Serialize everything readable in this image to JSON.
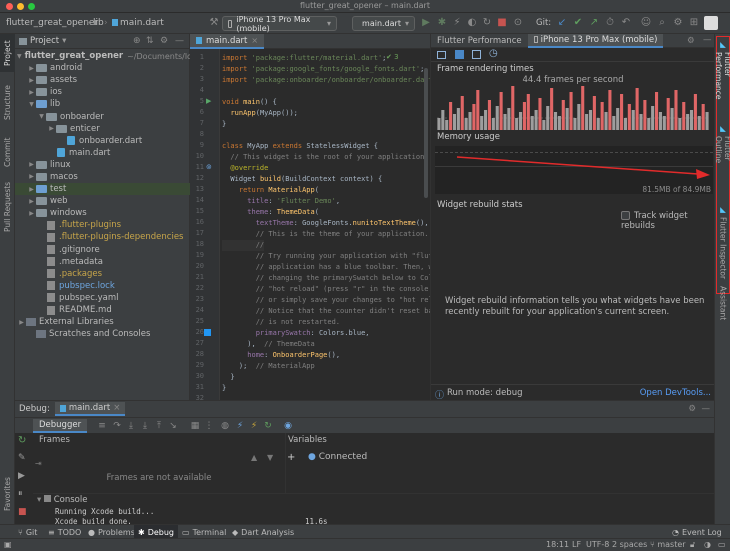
{
  "window": {
    "title": "flutter_great_opener – main.dart"
  },
  "navbar": {
    "breadcrumb": [
      "flutter_great_opener",
      "lib",
      "main.dart"
    ],
    "device_selector": "iPhone 13 Pro Max (mobile)",
    "run_config": "main.dart",
    "git_label": "Git:"
  },
  "left_strip": {
    "project": "Project",
    "structure": "Structure",
    "commit": "Commit",
    "pull_requests": "Pull Requests",
    "favorites": "Favorites"
  },
  "project_panel": {
    "title": "Project",
    "tree": [
      {
        "name": "flutter_great_opener",
        "suffix": "~/Documents/logrocket/flutter_great_opener",
        "indent": 0,
        "icon": "folder",
        "arrow": "open",
        "bold": true
      },
      {
        "name": "android",
        "indent": 1,
        "icon": "folder",
        "arrow": "closed",
        "color": ""
      },
      {
        "name": "assets",
        "indent": 1,
        "icon": "folder",
        "arrow": "closed",
        "color": ""
      },
      {
        "name": "ios",
        "indent": 1,
        "icon": "folder",
        "arrow": "closed",
        "color": ""
      },
      {
        "name": "lib",
        "indent": 1,
        "icon": "folder",
        "arrow": "open",
        "color": ""
      },
      {
        "name": "onboarder",
        "indent": 2,
        "icon": "folder",
        "arrow": "open",
        "color": ""
      },
      {
        "name": "enticer",
        "indent": 3,
        "icon": "folder",
        "arrow": "closed",
        "color": ""
      },
      {
        "name": "onboarder.dart",
        "indent": 4,
        "icon": "dart",
        "arrow": "",
        "color": ""
      },
      {
        "name": "main.dart",
        "indent": 3,
        "icon": "dart",
        "arrow": "",
        "color": ""
      },
      {
        "name": "linux",
        "indent": 1,
        "icon": "folder",
        "arrow": "closed",
        "color": ""
      },
      {
        "name": "macos",
        "indent": 1,
        "icon": "folder",
        "arrow": "closed",
        "color": ""
      },
      {
        "name": "test",
        "indent": 1,
        "icon": "folder",
        "arrow": "closed",
        "color": "",
        "highlight": true
      },
      {
        "name": "web",
        "indent": 1,
        "icon": "folder",
        "arrow": "closed",
        "color": ""
      },
      {
        "name": "windows",
        "indent": 1,
        "icon": "folder",
        "arrow": "closed",
        "color": ""
      },
      {
        "name": ".flutter-plugins",
        "indent": 2,
        "icon": "file",
        "arrow": "",
        "color": "ylw"
      },
      {
        "name": ".flutter-plugins-dependencies",
        "indent": 2,
        "icon": "file",
        "arrow": "",
        "color": "ylw"
      },
      {
        "name": ".gitignore",
        "indent": 2,
        "icon": "file",
        "arrow": "",
        "color": ""
      },
      {
        "name": ".metadata",
        "indent": 2,
        "icon": "file",
        "arrow": "",
        "color": ""
      },
      {
        "name": ".packages",
        "indent": 2,
        "icon": "file",
        "arrow": "",
        "color": "ylw"
      },
      {
        "name": "pubspec.lock",
        "indent": 2,
        "icon": "file",
        "arrow": "",
        "color": "blu"
      },
      {
        "name": "pubspec.yaml",
        "indent": 2,
        "icon": "file",
        "arrow": "",
        "color": ""
      },
      {
        "name": "README.md",
        "indent": 2,
        "icon": "file",
        "arrow": "",
        "color": ""
      },
      {
        "name": "External Libraries",
        "indent": 0,
        "icon": "lib",
        "arrow": "closed",
        "color": ""
      },
      {
        "name": "Scratches and Consoles",
        "indent": 1,
        "icon": "lib",
        "arrow": "",
        "color": ""
      }
    ]
  },
  "editor": {
    "tab": "main.dart",
    "inspection": "✔ 3",
    "line_numbers": [
      "1",
      "2",
      "3",
      "4",
      "5",
      "6",
      "7",
      "8",
      "9",
      "10",
      "11",
      "12",
      "13",
      "14",
      "15",
      "16",
      "17",
      "18",
      "19",
      "20",
      "21",
      "22",
      "23",
      "24",
      "25",
      "26",
      "27",
      "28",
      "29",
      "30",
      "31",
      "32"
    ],
    "lines": [
      [
        [
          "kw",
          "import "
        ],
        [
          "str",
          "'package:flutter/material.dart'"
        ],
        [
          "cls",
          ";"
        ]
      ],
      [
        [
          "kw",
          "import "
        ],
        [
          "str",
          "'package:google_fonts/google_fonts.dart'"
        ],
        [
          "cls",
          ";"
        ]
      ],
      [
        [
          "kw",
          "import "
        ],
        [
          "str",
          "'package:onboarder/onboarder/onboarder.dart'"
        ],
        [
          "cls",
          ";"
        ]
      ],
      [],
      [
        [
          "kw",
          "void "
        ],
        [
          "fn",
          "main"
        ],
        [
          "cls",
          "() {"
        ]
      ],
      [
        [
          "cls",
          "  "
        ],
        [
          "fn",
          "runApp"
        ],
        [
          "cls",
          "(MyApp());"
        ]
      ],
      [
        [
          "cls",
          "}"
        ]
      ],
      [],
      [
        [
          "kw",
          "class "
        ],
        [
          "cls",
          "MyApp "
        ],
        [
          "kw",
          "extends "
        ],
        [
          "cls",
          "StatelessWidget {"
        ]
      ],
      [
        [
          "cm",
          "  // This widget is the root of your application."
        ]
      ],
      [
        [
          "an",
          "  @override"
        ]
      ],
      [
        [
          "cls",
          "  Widget "
        ],
        [
          "fn",
          "build"
        ],
        [
          "cls",
          "(BuildContext context) {"
        ]
      ],
      [
        [
          "kw",
          "    return "
        ],
        [
          "fn",
          "MaterialApp"
        ],
        [
          "cls",
          "("
        ]
      ],
      [
        [
          "pr",
          "      title"
        ],
        [
          "cls",
          ": "
        ],
        [
          "str",
          "'Flutter Demo'"
        ],
        [
          "cls",
          ","
        ]
      ],
      [
        [
          "pr",
          "      theme"
        ],
        [
          "cls",
          ": "
        ],
        [
          "fn",
          "ThemeData"
        ],
        [
          "cls",
          "("
        ]
      ],
      [
        [
          "pr",
          "        textTheme"
        ],
        [
          "cls",
          ": GoogleFonts."
        ],
        [
          "fn",
          "nunitoTextTheme"
        ],
        [
          "cls",
          "(),"
        ]
      ],
      [
        [
          "cm",
          "        // This is the theme of your application."
        ]
      ],
      [
        [
          "cm",
          "        //"
        ]
      ],
      [
        [
          "cm",
          "        // Try running your application with \"flutter run\"."
        ]
      ],
      [
        [
          "cm",
          "        // application has a blue toolbar. Then, without"
        ]
      ],
      [
        [
          "cm",
          "        // changing the primarySwatch below to Colors.green"
        ]
      ],
      [
        [
          "cm",
          "        // \"hot reload\" (press \"r\" in the console where"
        ]
      ],
      [
        [
          "cm",
          "        // or simply save your changes to \"hot reload\" in"
        ]
      ],
      [
        [
          "cm",
          "        // Notice that the counter didn't reset back to zero;"
        ]
      ],
      [
        [
          "cm",
          "        // is not restarted."
        ]
      ],
      [
        [
          "pr",
          "        primarySwatch"
        ],
        [
          "cls",
          ": Colors.blue,"
        ]
      ],
      [
        [
          "cls",
          "      ),  "
        ],
        [
          "cm",
          "// ThemeData"
        ]
      ],
      [
        [
          "pr",
          "      home"
        ],
        [
          "cls",
          ": "
        ],
        [
          "fn",
          "OnboarderPage"
        ],
        [
          "cls",
          "(),"
        ]
      ],
      [
        [
          "cls",
          "    );  "
        ],
        [
          "cm",
          "// MaterialApp"
        ]
      ],
      [
        [
          "cls",
          "  }"
        ]
      ],
      [
        [
          "cls",
          "}"
        ]
      ],
      []
    ]
  },
  "flutter_panel": {
    "tabs": [
      "Flutter Performance",
      "iPhone 13 Pro Max (mobile)"
    ],
    "frame_title": "Frame rendering times",
    "fps": "44.4 frames per second",
    "frame_bars": [
      [
        12,
        "g"
      ],
      [
        20,
        "g"
      ],
      [
        10,
        "g"
      ],
      [
        28,
        "r"
      ],
      [
        16,
        "g"
      ],
      [
        22,
        "g"
      ],
      [
        34,
        "r"
      ],
      [
        12,
        "g"
      ],
      [
        18,
        "g"
      ],
      [
        26,
        "r"
      ],
      [
        40,
        "r"
      ],
      [
        14,
        "g"
      ],
      [
        20,
        "g"
      ],
      [
        30,
        "r"
      ],
      [
        12,
        "g"
      ],
      [
        24,
        "g"
      ],
      [
        38,
        "r"
      ],
      [
        16,
        "g"
      ],
      [
        22,
        "g"
      ],
      [
        44,
        "r"
      ],
      [
        12,
        "g"
      ],
      [
        18,
        "g"
      ],
      [
        28,
        "r"
      ],
      [
        36,
        "r"
      ],
      [
        14,
        "g"
      ],
      [
        20,
        "g"
      ],
      [
        32,
        "r"
      ],
      [
        10,
        "g"
      ],
      [
        24,
        "g"
      ],
      [
        42,
        "r"
      ],
      [
        18,
        "g"
      ],
      [
        14,
        "g"
      ],
      [
        30,
        "r"
      ],
      [
        22,
        "g"
      ],
      [
        38,
        "r"
      ],
      [
        12,
        "g"
      ],
      [
        26,
        "g"
      ],
      [
        44,
        "r"
      ],
      [
        16,
        "g"
      ],
      [
        20,
        "g"
      ],
      [
        34,
        "r"
      ],
      [
        12,
        "g"
      ],
      [
        28,
        "r"
      ],
      [
        18,
        "g"
      ],
      [
        40,
        "r"
      ],
      [
        14,
        "g"
      ],
      [
        22,
        "g"
      ],
      [
        36,
        "r"
      ],
      [
        12,
        "g"
      ],
      [
        26,
        "r"
      ],
      [
        20,
        "g"
      ],
      [
        42,
        "r"
      ],
      [
        16,
        "g"
      ],
      [
        30,
        "r"
      ],
      [
        12,
        "g"
      ],
      [
        24,
        "g"
      ],
      [
        38,
        "r"
      ],
      [
        18,
        "g"
      ],
      [
        14,
        "g"
      ],
      [
        32,
        "r"
      ],
      [
        22,
        "g"
      ],
      [
        40,
        "r"
      ],
      [
        12,
        "g"
      ],
      [
        28,
        "r"
      ],
      [
        16,
        "g"
      ],
      [
        20,
        "g"
      ],
      [
        36,
        "r"
      ],
      [
        14,
        "g"
      ],
      [
        26,
        "r"
      ],
      [
        18,
        "g"
      ]
    ],
    "memory_title": "Memory usage",
    "memory_value": "81.5MB of 84.9MB",
    "rebuild_title": "Widget rebuild stats",
    "track_label": "Track widget rebuilds",
    "rebuild_info": "Widget rebuild information tells you what widgets have been recently rebuilt for your application's current screen.",
    "run_mode": "Run mode: debug",
    "devtools": "Open DevTools..."
  },
  "right_strip": {
    "perf": "Flutter Performance",
    "outline": "Flutter Outline",
    "inspector": "Flutter Inspector",
    "assistant": "Assistant"
  },
  "debug": {
    "label": "Debug:",
    "run_tab": "main.dart",
    "debugger_tab": "Debugger",
    "frames_label": "Frames",
    "frames_empty": "Frames are not available",
    "variables_label": "Variables",
    "connected": "Connected",
    "console_label": "Console",
    "console_lines": [
      "Running Xcode build...",
      "Xcode build done."
    ],
    "build_time": "11.6s"
  },
  "bottom_tabs": {
    "git": "Git",
    "todo": "TODO",
    "problems": "Problems",
    "debug": "Debug",
    "terminal": "Terminal",
    "dart": "Dart Analysis",
    "event_log": "Event Log"
  },
  "status": {
    "pos": "18:11",
    "lf": "LF",
    "enc": "UTF-8",
    "indent": "2 spaces",
    "branch": "master"
  },
  "colors": {
    "accent": "#4a88c7",
    "bar_red": "#e06666",
    "bar_grey": "#9e9e9e",
    "highlight_box": "#e22b2b"
  }
}
